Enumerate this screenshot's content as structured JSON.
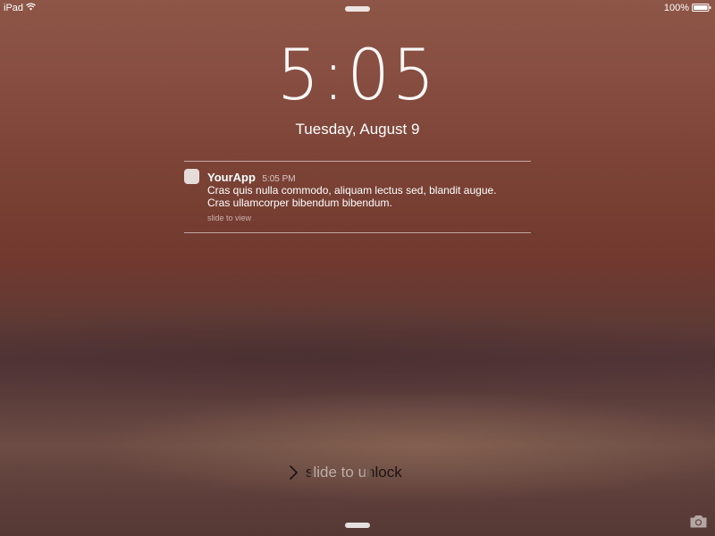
{
  "status_bar": {
    "device": "iPad",
    "battery_percent": "100%",
    "wifi_icon": "wifi-icon",
    "battery_icon": "battery-icon"
  },
  "lock_screen": {
    "time": "5:05",
    "date": "Tuesday, August 9"
  },
  "notification": {
    "app_icon": "app-icon",
    "app_name": "YourApp",
    "time": "5:05 PM",
    "line1": "Cras quis nulla commodo, aliquam lectus sed, blandit augue.",
    "line2": "Cras ullamcorper bibendum bibendum.",
    "action_hint": "slide to view"
  },
  "unlock": {
    "label": "slide to unlock",
    "icon": "chevron-right-icon"
  },
  "camera": {
    "icon": "camera-icon"
  },
  "colors": {
    "text": "#ffffff",
    "app_icon_bg": "#e6dcd9",
    "background_top": "#8d5646",
    "background_bottom": "#553734"
  }
}
